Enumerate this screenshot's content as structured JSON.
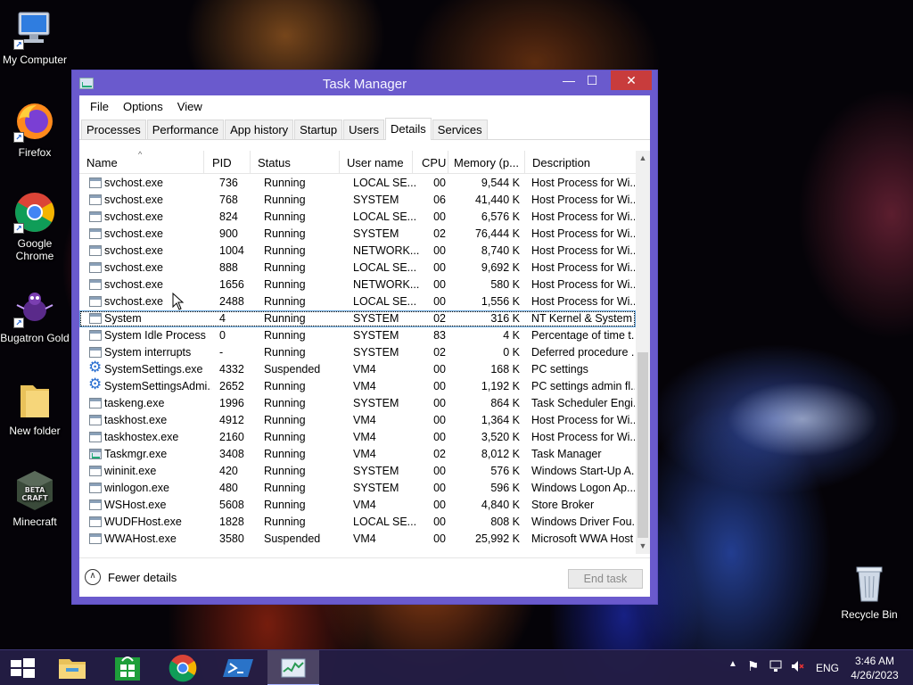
{
  "desktop": {
    "icons": [
      {
        "label": "My Computer"
      },
      {
        "label": "Firefox"
      },
      {
        "label": "Google Chrome"
      },
      {
        "label": "Bugatron Gold"
      },
      {
        "label": "New folder"
      },
      {
        "label": "Minecraft"
      },
      {
        "label": "Recycle Bin"
      }
    ],
    "minecraft_logo": "BETA CRAFT"
  },
  "window": {
    "title": "Task Manager",
    "minimize_glyph": "—",
    "maximize_glyph": "☐",
    "close_glyph": "✕"
  },
  "menu": {
    "items": [
      "File",
      "Options",
      "View"
    ]
  },
  "tabs": {
    "items": [
      "Processes",
      "Performance",
      "App history",
      "Startup",
      "Users",
      "Details",
      "Services"
    ],
    "active": "Details"
  },
  "table": {
    "columns": [
      "Name",
      "PID",
      "Status",
      "User name",
      "CPU",
      "Memory (p...",
      "Description"
    ],
    "sort_glyph": "^",
    "rows": [
      {
        "name": "svchost.exe",
        "pid": "736",
        "status": "Running",
        "user": "LOCAL SE...",
        "cpu": "00",
        "mem": "9,544 K",
        "desc": "Host Process for Wi...",
        "icon": "window"
      },
      {
        "name": "svchost.exe",
        "pid": "768",
        "status": "Running",
        "user": "SYSTEM",
        "cpu": "06",
        "mem": "41,440 K",
        "desc": "Host Process for Wi...",
        "icon": "window"
      },
      {
        "name": "svchost.exe",
        "pid": "824",
        "status": "Running",
        "user": "LOCAL SE...",
        "cpu": "00",
        "mem": "6,576 K",
        "desc": "Host Process for Wi...",
        "icon": "window"
      },
      {
        "name": "svchost.exe",
        "pid": "900",
        "status": "Running",
        "user": "SYSTEM",
        "cpu": "02",
        "mem": "76,444 K",
        "desc": "Host Process for Wi...",
        "icon": "window"
      },
      {
        "name": "svchost.exe",
        "pid": "1004",
        "status": "Running",
        "user": "NETWORK...",
        "cpu": "00",
        "mem": "8,740 K",
        "desc": "Host Process for Wi...",
        "icon": "window"
      },
      {
        "name": "svchost.exe",
        "pid": "888",
        "status": "Running",
        "user": "LOCAL SE...",
        "cpu": "00",
        "mem": "9,692 K",
        "desc": "Host Process for Wi...",
        "icon": "window"
      },
      {
        "name": "svchost.exe",
        "pid": "1656",
        "status": "Running",
        "user": "NETWORK...",
        "cpu": "00",
        "mem": "580 K",
        "desc": "Host Process for Wi...",
        "icon": "window"
      },
      {
        "name": "svchost.exe",
        "pid": "2488",
        "status": "Running",
        "user": "LOCAL SE...",
        "cpu": "00",
        "mem": "1,556 K",
        "desc": "Host Process for Wi...",
        "icon": "window"
      },
      {
        "name": "System",
        "pid": "4",
        "status": "Running",
        "user": "SYSTEM",
        "cpu": "02",
        "mem": "316 K",
        "desc": "NT Kernel & System",
        "icon": "window"
      },
      {
        "name": "System Idle Process",
        "pid": "0",
        "status": "Running",
        "user": "SYSTEM",
        "cpu": "83",
        "mem": "4 K",
        "desc": "Percentage of time t...",
        "icon": "window"
      },
      {
        "name": "System interrupts",
        "pid": "-",
        "status": "Running",
        "user": "SYSTEM",
        "cpu": "02",
        "mem": "0 K",
        "desc": "Deferred procedure ...",
        "icon": "window"
      },
      {
        "name": "SystemSettings.exe",
        "pid": "4332",
        "status": "Suspended",
        "user": "VM4",
        "cpu": "00",
        "mem": "168 K",
        "desc": "PC settings",
        "icon": "gear"
      },
      {
        "name": "SystemSettingsAdmi...",
        "pid": "2652",
        "status": "Running",
        "user": "VM4",
        "cpu": "00",
        "mem": "1,192 K",
        "desc": "PC settings admin fl...",
        "icon": "gear"
      },
      {
        "name": "taskeng.exe",
        "pid": "1996",
        "status": "Running",
        "user": "SYSTEM",
        "cpu": "00",
        "mem": "864 K",
        "desc": "Task Scheduler Engi...",
        "icon": "window"
      },
      {
        "name": "taskhost.exe",
        "pid": "4912",
        "status": "Running",
        "user": "VM4",
        "cpu": "00",
        "mem": "1,364 K",
        "desc": "Host Process for Wi...",
        "icon": "window"
      },
      {
        "name": "taskhostex.exe",
        "pid": "2160",
        "status": "Running",
        "user": "VM4",
        "cpu": "00",
        "mem": "3,520 K",
        "desc": "Host Process for Wi...",
        "icon": "window"
      },
      {
        "name": "Taskmgr.exe",
        "pid": "3408",
        "status": "Running",
        "user": "VM4",
        "cpu": "02",
        "mem": "8,012 K",
        "desc": "Task Manager",
        "icon": "taskmgr"
      },
      {
        "name": "wininit.exe",
        "pid": "420",
        "status": "Running",
        "user": "SYSTEM",
        "cpu": "00",
        "mem": "576 K",
        "desc": "Windows Start-Up A...",
        "icon": "window"
      },
      {
        "name": "winlogon.exe",
        "pid": "480",
        "status": "Running",
        "user": "SYSTEM",
        "cpu": "00",
        "mem": "596 K",
        "desc": "Windows Logon Ap...",
        "icon": "window"
      },
      {
        "name": "WSHost.exe",
        "pid": "5608",
        "status": "Running",
        "user": "VM4",
        "cpu": "00",
        "mem": "4,840 K",
        "desc": "Store Broker",
        "icon": "window"
      },
      {
        "name": "WUDFHost.exe",
        "pid": "1828",
        "status": "Running",
        "user": "LOCAL SE...",
        "cpu": "00",
        "mem": "808 K",
        "desc": "Windows Driver Fou...",
        "icon": "window"
      },
      {
        "name": "WWAHost.exe",
        "pid": "3580",
        "status": "Suspended",
        "user": "VM4",
        "cpu": "00",
        "mem": "25,992 K",
        "desc": "Microsoft WWA Host",
        "icon": "window"
      }
    ],
    "selected_row": 8
  },
  "footer": {
    "fewer_details": "Fewer details",
    "fewer_glyph": "∧",
    "end_task": "End task"
  },
  "taskbar": {
    "items": [
      "start-button",
      "file-explorer",
      "store",
      "chrome",
      "powershell",
      "task-manager"
    ],
    "active": "task-manager",
    "language": "ENG",
    "time": "3:46 AM",
    "date": "4/26/2023"
  },
  "colors": {
    "window_frame": "#6a5acd",
    "close_button": "#c83c3c",
    "taskbar": "#241e46"
  }
}
